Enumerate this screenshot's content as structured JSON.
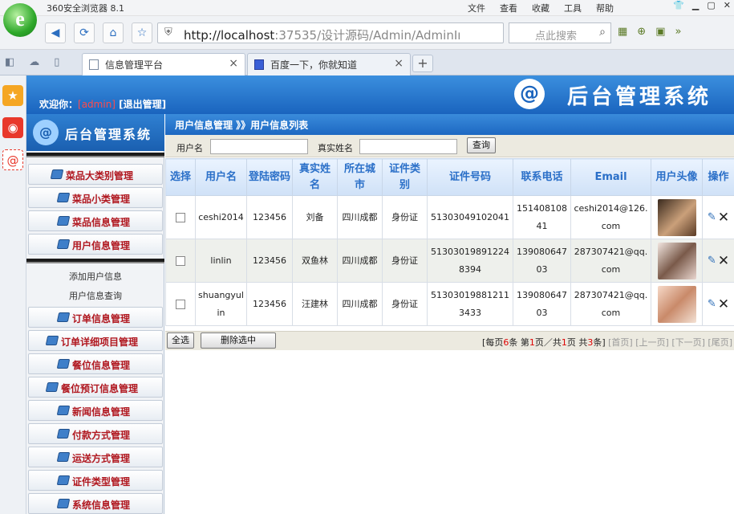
{
  "browser": {
    "title": "360安全浏览器 8.1",
    "menu": [
      "文件",
      "查看",
      "收藏",
      "工具",
      "帮助"
    ],
    "url_host": "http://localhost",
    "url_rest": ":37535/设计源码/Admin/AdminIı",
    "search_placeholder": "点此搜索",
    "tabs": [
      {
        "label": "信息管理平台"
      },
      {
        "label": "百度一下，你就知道"
      }
    ]
  },
  "header": {
    "welcome_prefix": "欢迎你：",
    "admin_user": "[admin]",
    "logout": "[退出管理]",
    "brand": "后台管理系统",
    "brand_at": "@"
  },
  "sidebar": {
    "logo_text": "后台管理系统",
    "menu": [
      {
        "label": "菜品大类别管理"
      },
      {
        "label": "菜品小类管理"
      },
      {
        "label": "菜品信息管理"
      },
      {
        "label": "用户信息管理"
      }
    ],
    "sub": [
      {
        "label": "添加用户信息"
      },
      {
        "label": "用户信息查询"
      }
    ],
    "menu2": [
      {
        "label": "订单信息管理"
      },
      {
        "label": "订单详细项目管理"
      },
      {
        "label": "餐位信息管理"
      },
      {
        "label": "餐位预订信息管理"
      },
      {
        "label": "新闻信息管理"
      },
      {
        "label": "付款方式管理"
      },
      {
        "label": "运送方式管理"
      },
      {
        "label": "证件类型管理"
      },
      {
        "label": "系统信息管理"
      }
    ]
  },
  "main": {
    "breadcrumb": "用户信息管理 》》用户信息列表",
    "filter": {
      "username_label": "用户名",
      "realname_label": "真实姓名",
      "query_button": "查询"
    },
    "table": {
      "headers": [
        "选择",
        "用户名",
        "登陆密码",
        "真实姓名",
        "所在城市",
        "证件类别",
        "证件号码",
        "联系电话",
        "Email",
        "用户头像",
        "操作"
      ],
      "rows": [
        {
          "username": "ceshi2014",
          "password": "123456",
          "realname": "刘备",
          "city": "四川成都",
          "idtype": "身份证",
          "idno": "51303049102041",
          "phone": "15140810841",
          "email": "ceshi2014@126.com"
        },
        {
          "username": "linlin",
          "password": "123456",
          "realname": "双鱼林",
          "city": "四川成都",
          "idtype": "身份证",
          "idno": "513030198912248394",
          "phone": "13908064703",
          "email": "287307421@qq.com"
        },
        {
          "username": "shuangyulin",
          "password": "123456",
          "realname": "汪建林",
          "city": "四川成都",
          "idtype": "身份证",
          "idno": "513030198812113433",
          "phone": "13908064703",
          "email": "287307421@qq.com"
        }
      ]
    },
    "footer": {
      "select_all": "全选",
      "delete_selected": "删除选中",
      "pager_prefix": "[每页",
      "per_page": "6",
      "pager_mid1": "条 第",
      "current_page": "1",
      "pager_mid2": "页／共",
      "total_pages": "1",
      "pager_mid3": "页 共",
      "total_items": "3",
      "pager_suffix": "条]",
      "first": "[首页]",
      "prev": "[上一页]",
      "next": "[下一页]",
      "last": "[尾页]"
    }
  },
  "colors": {
    "accent": "#1a64be",
    "menu_text": "#b0171f",
    "header_text": "#2a6fc8"
  }
}
